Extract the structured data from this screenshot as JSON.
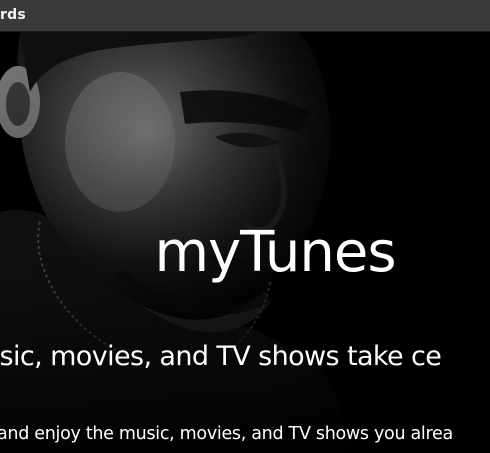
{
  "topbar": {
    "label": "rds"
  },
  "hero": {
    "title": "myTunes",
    "subtitle": "usic, movies, and TV shows take ce",
    "body": "and enjoy the music, movies, and TV shows you alrea",
    "image": "black-and-white-portrait-photo"
  },
  "colors": {
    "topbar_background": "#3a3a3a",
    "hero_background": "#000000",
    "text": "#ffffff"
  }
}
